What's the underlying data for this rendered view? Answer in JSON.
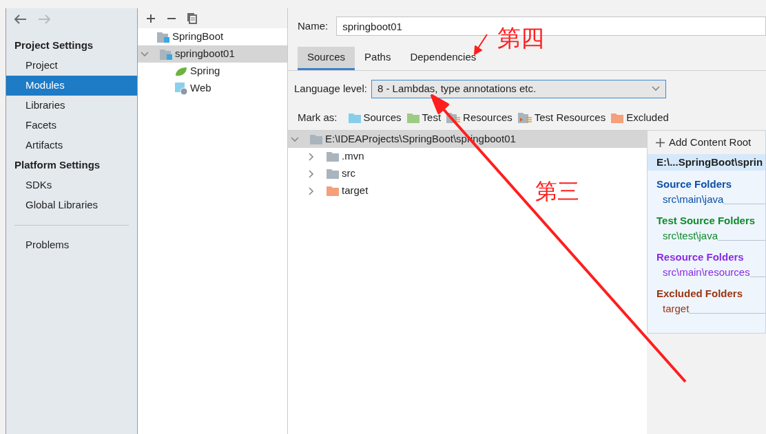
{
  "sidebar": {
    "sections": [
      {
        "title": "Project Settings",
        "items": [
          {
            "label": "Project",
            "selected": false
          },
          {
            "label": "Modules",
            "selected": true
          },
          {
            "label": "Libraries",
            "selected": false
          },
          {
            "label": "Facets",
            "selected": false
          },
          {
            "label": "Artifacts",
            "selected": false
          }
        ]
      },
      {
        "title": "Platform Settings",
        "items": [
          {
            "label": "SDKs",
            "selected": false
          },
          {
            "label": "Global Libraries",
            "selected": false
          }
        ]
      }
    ],
    "bottom_items": [
      {
        "label": "Problems",
        "selected": false
      }
    ]
  },
  "module_tree": [
    {
      "label": "SpringBoot",
      "kind": "module",
      "selected": false
    },
    {
      "label": "springboot01",
      "kind": "module",
      "selected": true,
      "expanded": true,
      "children": [
        {
          "label": "Spring",
          "kind": "spring",
          "selected": false
        },
        {
          "label": "Web",
          "kind": "web",
          "selected": false
        }
      ]
    }
  ],
  "name_field": {
    "label": "Name:",
    "value": "springboot01"
  },
  "tabs": [
    {
      "label": "Sources",
      "selected": true
    },
    {
      "label": "Paths",
      "selected": false
    },
    {
      "label": "Dependencies",
      "selected": false
    }
  ],
  "language_level": {
    "label": "Language level:",
    "value": "8 - Lambdas, type annotations etc."
  },
  "mark_as": {
    "label": "Mark as:",
    "buttons": [
      {
        "label": "Sources",
        "kind": "sources"
      },
      {
        "label": "Test",
        "kind": "tests"
      },
      {
        "label": "Resources",
        "kind": "resources"
      },
      {
        "label": "Test Resources",
        "kind": "test_resources"
      },
      {
        "label": "Excluded",
        "kind": "excluded"
      }
    ]
  },
  "content_tree": [
    {
      "label": "E:\\IDEAProjects\\SpringBoot\\springboot01",
      "kind": "folder",
      "selected": true,
      "expanded": true,
      "children": [
        {
          "label": ".mvn",
          "kind": "folder",
          "selected": false,
          "expanded": false
        },
        {
          "label": "src",
          "kind": "folder",
          "selected": false,
          "expanded": false
        },
        {
          "label": "target",
          "kind": "excluded",
          "selected": false,
          "expanded": false
        }
      ]
    }
  ],
  "content_root_panel": {
    "add_button": "Add Content Root",
    "root_path": "E:\\...SpringBoot\\sprin",
    "groups": [
      {
        "title": "Source Folders",
        "color": "#0b4fa5",
        "paths": [
          "src\\main\\java"
        ]
      },
      {
        "title": "Test Source Folders",
        "color": "#108a2c",
        "paths": [
          "src\\test\\java"
        ]
      },
      {
        "title": "Resource Folders",
        "color": "#8a2be2",
        "paths": [
          "src\\main\\resources"
        ]
      },
      {
        "title": "Excluded Folders",
        "color": "#9a3412",
        "paths": [
          "target"
        ]
      }
    ]
  },
  "annotations": [
    {
      "text": "第四"
    },
    {
      "text": "第三"
    }
  ]
}
